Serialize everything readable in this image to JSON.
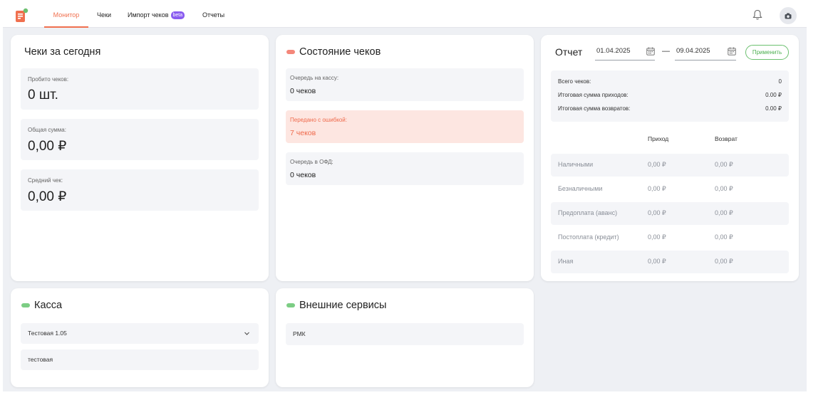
{
  "nav": {
    "items": [
      {
        "label": "Монитор",
        "active": true
      },
      {
        "label": "Чеки",
        "active": false
      },
      {
        "label": "Импорт чеков",
        "badge": "beta",
        "active": false
      },
      {
        "label": "Отчеты",
        "active": false
      }
    ],
    "icons": [
      "logo-icon",
      "bell-icon",
      "camera-icon"
    ]
  },
  "today": {
    "title": "Чеки за сегодня",
    "punched_label": "Пробито чеков:",
    "punched_value": "0 шт.",
    "total_label": "Общая сумма:",
    "total_value": "0,00 ₽",
    "avg_label": "Средний чек:",
    "avg_value": "0,00 ₽"
  },
  "status": {
    "title": "Состояние чеков",
    "indicator_color": "#f4877a",
    "queue_label": "Очередь на кассу:",
    "queue_value": "0 чеков",
    "error_label": "Передано с ошибкой:",
    "error_value": "7 чеков",
    "ofd_label": "Очередь в ОФД:",
    "ofd_value": "0 чеков"
  },
  "report": {
    "title": "Отчет",
    "date_from": "01.04.2025",
    "date_sep": "—",
    "date_to": "09.04.2025",
    "apply_label": "Применить",
    "summary": [
      {
        "label": "Всего чеков:",
        "value": "0"
      },
      {
        "label": "Итоговая сумма приходов:",
        "value": "0.00 ₽"
      },
      {
        "label": "Итоговая сумма возвратов:",
        "value": "0.00 ₽"
      }
    ],
    "col_income": "Приход",
    "col_refund": "Возврат",
    "rows": [
      {
        "label": "Наличными",
        "income": "0,00 ₽",
        "refund": "0,00 ₽"
      },
      {
        "label": "Безналичными",
        "income": "0,00 ₽",
        "refund": "0,00 ₽"
      },
      {
        "label": "Предоплата (аванс)",
        "income": "0,00 ₽",
        "refund": "0,00 ₽"
      },
      {
        "label": "Постоплата (кредит)",
        "income": "0,00 ₽",
        "refund": "0,00 ₽"
      },
      {
        "label": "Иная",
        "income": "0,00 ₽",
        "refund": "0,00 ₽"
      }
    ]
  },
  "kassa": {
    "title": "Касса",
    "indicator_color": "#7ccd84",
    "selected": "Тестовая 1.05",
    "item": "тестовая"
  },
  "external": {
    "title": "Внешние сервисы",
    "indicator_color": "#7ccd84",
    "item": "РМК"
  },
  "colors": {
    "accent": "#f0704f",
    "beta_badge": "#8a5cf0",
    "apply_green": "#4caf50",
    "error_bg": "#fde6e1"
  }
}
